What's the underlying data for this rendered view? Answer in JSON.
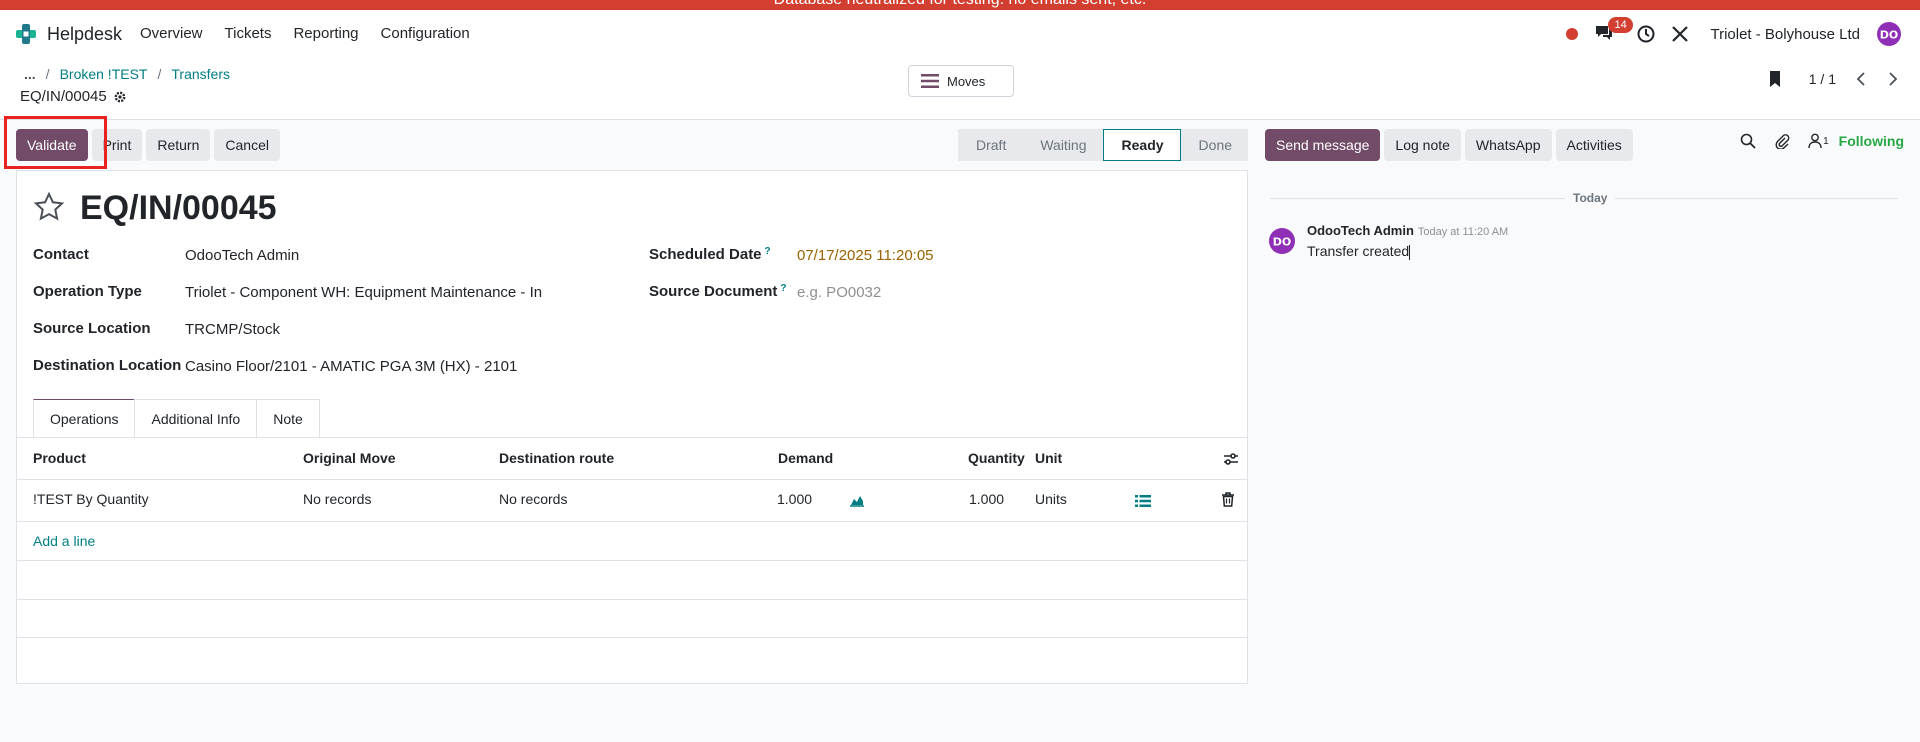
{
  "banner": {
    "text": "Database neutralized for testing: no emails sent, etc."
  },
  "navbar": {
    "app_name": "Helpdesk",
    "menu": [
      "Overview",
      "Tickets",
      "Reporting",
      "Configuration"
    ],
    "chat_badge": "14",
    "company": "Triolet - Bolyhouse Ltd"
  },
  "control": {
    "breadcrumb": {
      "ellipsis": "...",
      "items": [
        "Broken !TEST",
        "Transfers"
      ]
    },
    "record_name": "EQ/IN/00045",
    "moves_label": "Moves",
    "pager": "1 / 1"
  },
  "actions": {
    "validate": "Validate",
    "print": "Print",
    "return": "Return",
    "cancel": "Cancel"
  },
  "statusbar": {
    "stages": [
      "Draft",
      "Waiting",
      "Ready",
      "Done"
    ],
    "active": "Ready"
  },
  "form": {
    "title": "EQ/IN/00045",
    "contact_label": "Contact",
    "contact_value": "OdooTech Admin",
    "optype_label": "Operation Type",
    "optype_value": "Triolet - Component WH: Equipment Maintenance - In",
    "src_loc_label": "Source Location",
    "src_loc_value": "TRCMP/Stock",
    "dest_loc_label": "Destination Location",
    "dest_loc_value": "Casino Floor/2101 - AMATIC PGA 3M (HX) - 2101",
    "sched_label": "Scheduled Date",
    "sched_value": "07/17/2025 11:20:05",
    "srcdoc_label": "Source Document",
    "srcdoc_placeholder": "e.g. PO0032",
    "help_mark": "?"
  },
  "tabs": [
    "Operations",
    "Additional Info",
    "Note"
  ],
  "table": {
    "headers": {
      "product": "Product",
      "orig": "Original Move",
      "dest": "Destination route",
      "demand": "Demand",
      "qty": "Quantity",
      "unit": "Unit"
    },
    "row": {
      "product": "!TEST By Quantity",
      "orig": "No records",
      "dest": "No records",
      "demand": "1.000",
      "qty": "1.000",
      "unit": "Units"
    },
    "add_line": "Add a line"
  },
  "chatter": {
    "send": "Send message",
    "log": "Log note",
    "whatsapp": "WhatsApp",
    "activities": "Activities",
    "followers_count": "1",
    "following": "Following",
    "date_sep": "Today",
    "author": "OdooTech Admin",
    "time": "Today at 11:20 AM",
    "body": "Transfer created"
  },
  "colors": {
    "brand": "#714b67",
    "accent": "#017e84",
    "banner": "#d23f31",
    "highlight": "#e8231f"
  }
}
